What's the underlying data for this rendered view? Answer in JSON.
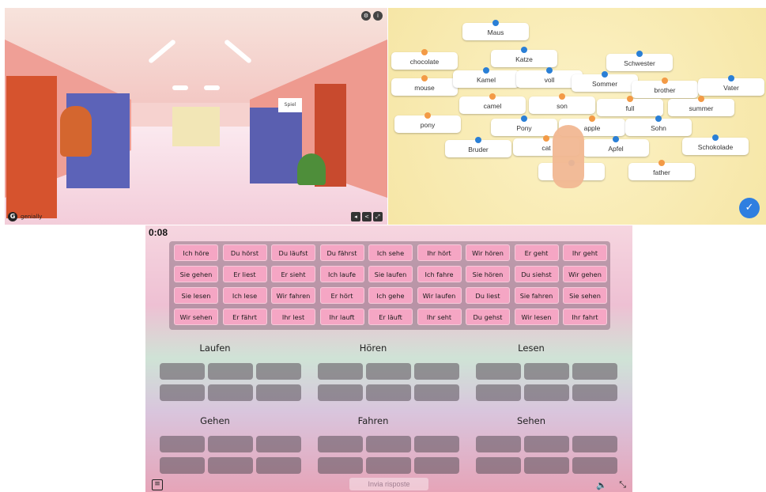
{
  "panel1": {
    "sign_text": "Spiel",
    "brand": "genially",
    "icons": [
      "settings-icon",
      "info-icon",
      "volume-icon",
      "share-icon",
      "fullscreen-icon"
    ]
  },
  "panel2": {
    "cards": [
      {
        "text": "Maus",
        "pin": "b"
      },
      {
        "text": "chocolate",
        "pin": "o"
      },
      {
        "text": "Katze",
        "pin": "b"
      },
      {
        "text": "Schwester",
        "pin": "b"
      },
      {
        "text": "mouse",
        "pin": "o"
      },
      {
        "text": "Kamel",
        "pin": "b"
      },
      {
        "text": "voll",
        "pin": "b"
      },
      {
        "text": "Sommer",
        "pin": "b"
      },
      {
        "text": "brother",
        "pin": "o"
      },
      {
        "text": "Vater",
        "pin": "b"
      },
      {
        "text": "camel",
        "pin": "o"
      },
      {
        "text": "son",
        "pin": "o"
      },
      {
        "text": "full",
        "pin": "o"
      },
      {
        "text": "summer",
        "pin": "o"
      },
      {
        "text": "pony",
        "pin": "o"
      },
      {
        "text": "Pony",
        "pin": "b"
      },
      {
        "text": "apple",
        "pin": "o"
      },
      {
        "text": "Sohn",
        "pin": "b"
      },
      {
        "text": "Bruder",
        "pin": "b"
      },
      {
        "text": "cat",
        "pin": "o"
      },
      {
        "text": "Apfel",
        "pin": "b"
      },
      {
        "text": "Schokolade",
        "pin": "b"
      },
      {
        "text": "father",
        "pin": "o"
      },
      {
        "text": "",
        "pin": "b"
      }
    ]
  },
  "panel3": {
    "timer": "0:08",
    "chips": [
      [
        "Ich höre",
        "Du hörst",
        "Du läufst",
        "Du fährst",
        "Ich sehe",
        "Ihr hört",
        "Wir hören",
        "Er geht",
        "Ihr geht"
      ],
      [
        "Sie gehen",
        "Er liest",
        "Er sieht",
        "Ich laufe",
        "Sie laufen",
        "Ich fahre",
        "Sie hören",
        "Du siehst",
        "Wir gehen"
      ],
      [
        "Sie lesen",
        "Ich lese",
        "Wir fahren",
        "Er hört",
        "Ich gehe",
        "Wir laufen",
        "Du liest",
        "Sie fahren",
        "Sie sehen"
      ],
      [
        "Wir sehen",
        "Er fährt",
        "Ihr lest",
        "Ihr lauft",
        "Er läuft",
        "Ihr seht",
        "Du gehst",
        "Wir lesen",
        "Ihr fahrt"
      ]
    ],
    "groups": [
      "Laufen",
      "Hören",
      "Lesen",
      "Gehen",
      "Fahren",
      "Sehen"
    ],
    "send_label": "Invia risposte"
  }
}
